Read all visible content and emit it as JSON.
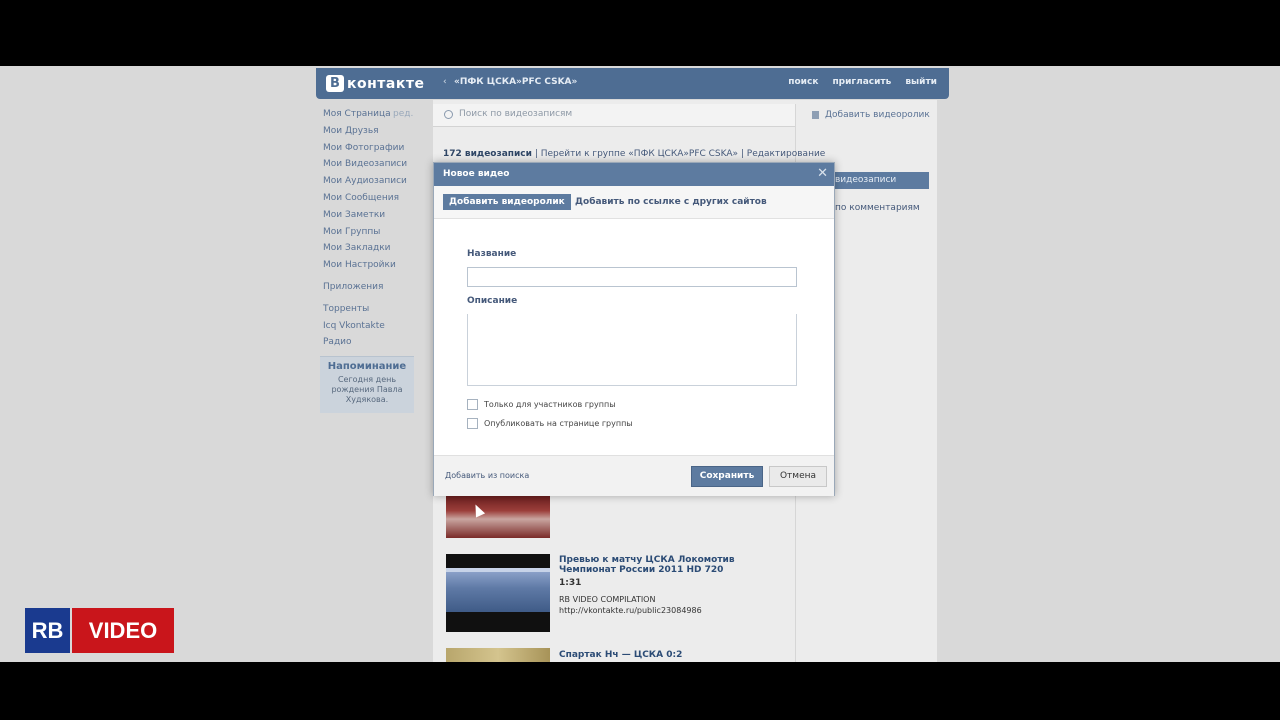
{
  "header": {
    "logo_mark": "В",
    "logo_text": "контакте",
    "back_arrow": "‹",
    "group_title": "«ПФК ЦСКА»PFC CSKA»",
    "links": [
      "поиск",
      "пригласить",
      "выйти"
    ]
  },
  "sidebar": {
    "edit_label": "ред.",
    "items": [
      "Моя Страница",
      "Мои Друзья",
      "Мои Фотографии",
      "Мои Видеозаписи",
      "Мои Аудиозаписи",
      "Мои Сообщения",
      "Мои Заметки",
      "Мои Группы",
      "Мои Закладки",
      "Мои Настройки",
      "Приложения",
      "Торренты",
      "Icq Vkontakte",
      "Радио"
    ]
  },
  "reminder": {
    "title": "Напоминание",
    "text": "Сегодня день рождения Павла Худякова."
  },
  "videos_page": {
    "search_placeholder": "Поиск по видеозаписям",
    "add_video_label": "Добавить видеоролик",
    "summary_count": "172 видеозаписи",
    "summary_rest": " | Перейти к группе «ПФК ЦСКА»PFC CSKA» | Редактирование",
    "right_bar_label": "видеозаписи",
    "right_link": "по комментариям",
    "videos": [
      {
        "title": "Превью к матчу ЦСКА Локомотив Чемпионат России 2011 HD 720",
        "duration": "1:31",
        "author": "RB VIDEO COMPILATION",
        "link": "http://vkontakte.ru/public23084986"
      },
      {
        "title": "Спартак Нч — ЦСКА 0:2"
      }
    ]
  },
  "modal": {
    "title": "Новое видео",
    "close_glyph": "✕",
    "tab_active": "Добавить видеоролик",
    "tab_other": "Добавить по ссылке с других сайтов",
    "label_title": "Название",
    "label_description": "Описание",
    "checkbox_members_only": "Только для участников группы",
    "checkbox_publish": "Опубликовать на странице группы",
    "footer_link": "Добавить из поиска",
    "save_button": "Сохранить",
    "cancel_button": "Отмена"
  },
  "watermark": {
    "left": "RB",
    "right": "VIDEO"
  },
  "colors": {
    "accent": "#5d7ba0",
    "header": "#4e6d93",
    "watermark_blue": "#1a3a8f",
    "watermark_red": "#c9151b"
  }
}
